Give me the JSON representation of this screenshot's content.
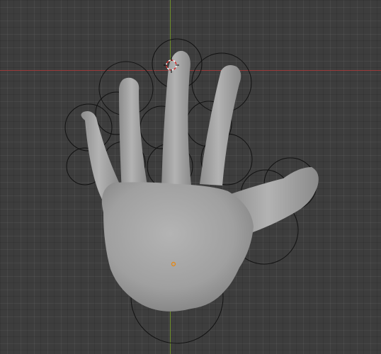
{
  "viewport": {
    "background_color": "#3d3d3d",
    "x_axis_color": "#9a3a3a",
    "y_axis_color": "#6f8f2a",
    "grid": true
  },
  "object": {
    "type": "mesh",
    "shape": "hand",
    "color": "#9c9c9c",
    "origin_color": "#e08a1e"
  },
  "helpers": {
    "bone_envelope_circles": true,
    "circle_color": "#111111",
    "cursor_3d": "cursor-3d-icon"
  }
}
